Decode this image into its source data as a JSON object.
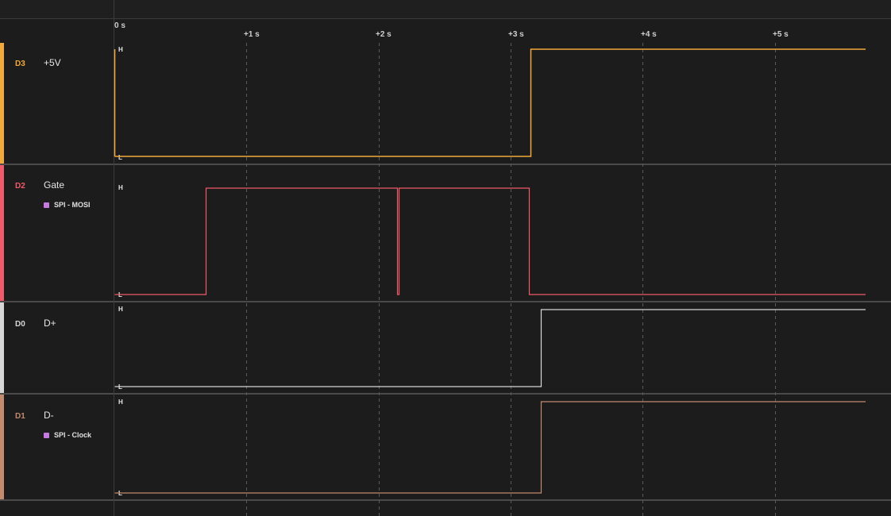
{
  "timeline": {
    "origin_label": "0 s",
    "ticks": [
      "+1 s",
      "+2 s",
      "+3 s",
      "+4 s",
      "+5 s"
    ]
  },
  "channels": [
    {
      "id": "D3",
      "name": "+5V",
      "color": "#f2a93b",
      "analyzer": "",
      "high_label": "H",
      "low_label": "L",
      "waveform": [
        [
          0.0,
          0
        ],
        [
          3.15,
          1
        ]
      ]
    },
    {
      "id": "D2",
      "name": "Gate",
      "color": "#f05a6a",
      "analyzer": "SPI - MOSI",
      "high_label": "H",
      "low_label": "L",
      "waveform": [
        [
          0.0,
          0
        ],
        [
          0.69,
          1
        ],
        [
          2.14,
          0
        ],
        [
          2.15,
          1
        ],
        [
          3.14,
          0
        ]
      ]
    },
    {
      "id": "D0",
      "name": "D+",
      "color": "#d6d6d6",
      "analyzer": "",
      "high_label": "H",
      "low_label": "L",
      "waveform": [
        [
          0.0,
          0
        ],
        [
          3.23,
          1
        ]
      ]
    },
    {
      "id": "D1",
      "name": "D-",
      "color": "#c28a6e",
      "analyzer": "SPI - Clock",
      "high_label": "H",
      "low_label": "L",
      "waveform": [
        [
          0.0,
          0
        ],
        [
          3.23,
          1
        ]
      ]
    }
  ],
  "colors": {
    "analyzer_dot": "#c47adf",
    "background": "#1c1c1c",
    "grid": "#5a5a5a"
  }
}
